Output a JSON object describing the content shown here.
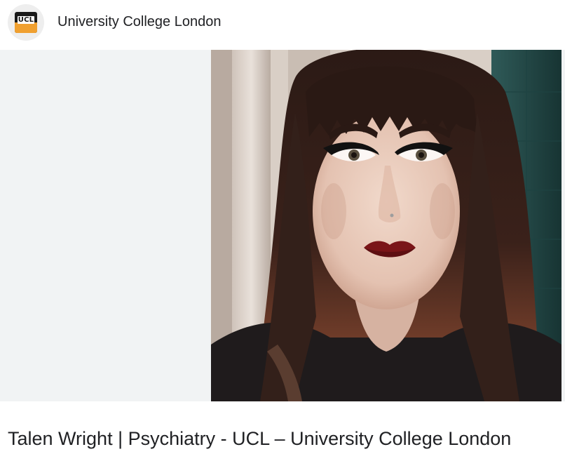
{
  "header": {
    "site_name": "University College London",
    "favicon_icon": "ucl-logo-icon",
    "favicon_text": "UCL",
    "favicon_colors": {
      "top": "#1a1a1a",
      "bottom": "#f0a030"
    }
  },
  "image": {
    "subject": "portrait-photo",
    "background_color": "#f1f3f4"
  },
  "result": {
    "title": "Talen Wright | Psychiatry - UCL – University College London"
  }
}
